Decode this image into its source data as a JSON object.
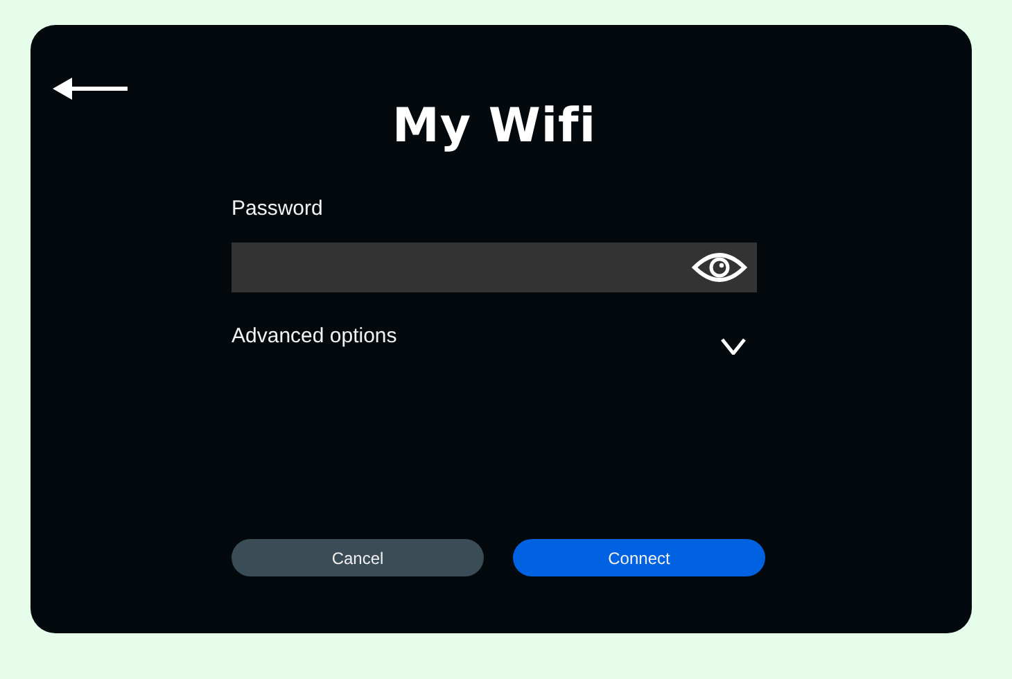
{
  "title": "My Wifi",
  "password": {
    "label": "Password",
    "revealed": false
  },
  "advanced": {
    "label": "Advanced options",
    "expanded": false
  },
  "buttons": [
    {
      "label": "Cancel",
      "kind": "secondary"
    },
    {
      "label": "Connect",
      "kind": "primary"
    }
  ]
}
